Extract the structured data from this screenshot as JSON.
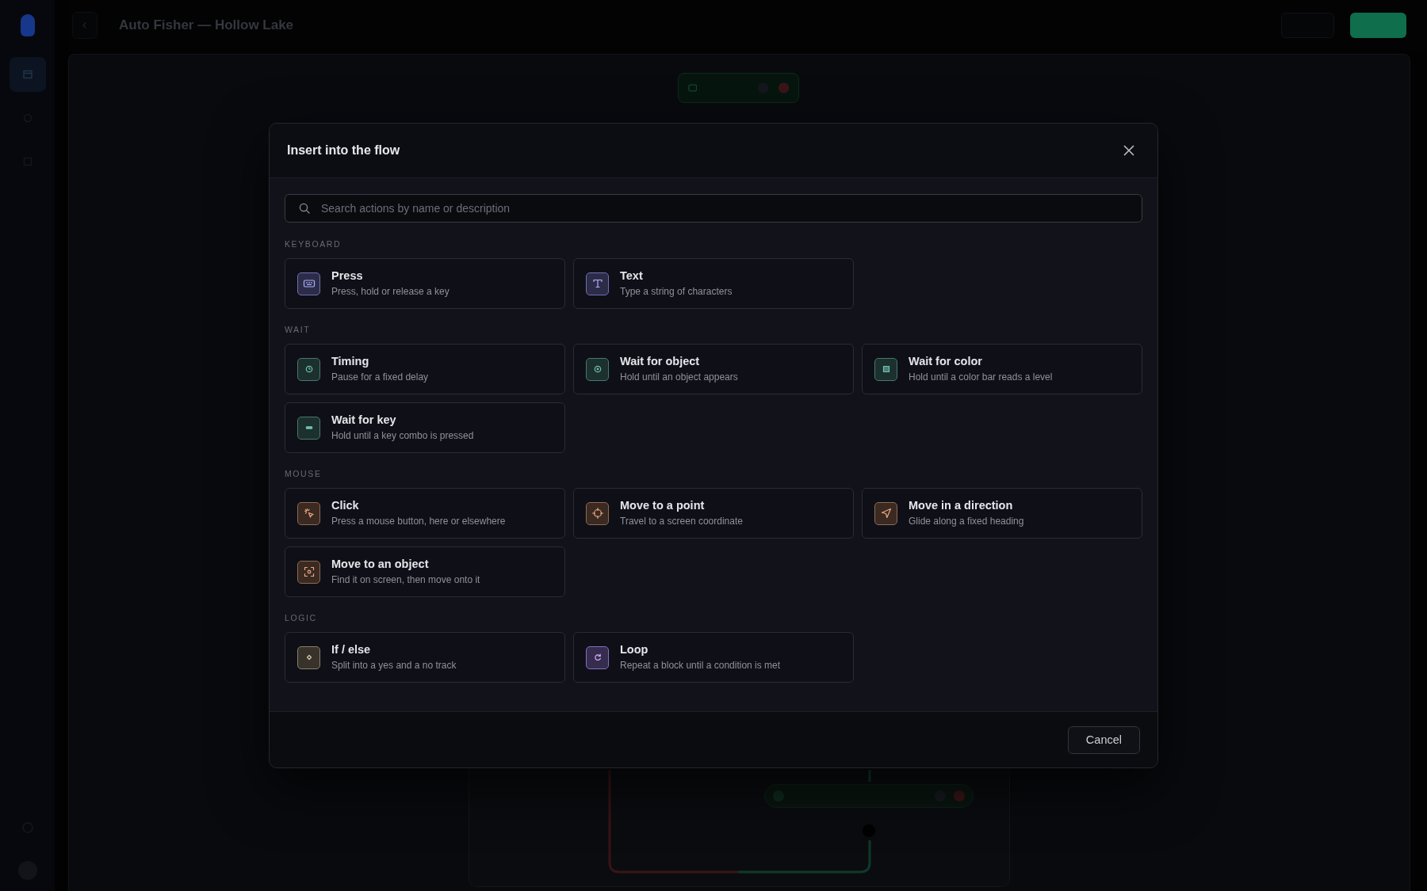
{
  "app": {
    "title": "Auto Fisher — Hollow Lake"
  },
  "sidebar": {
    "items": [
      {
        "selected": true
      },
      {
        "selected": false
      },
      {
        "selected": false
      }
    ]
  },
  "dialog": {
    "title": "Insert into the flow",
    "search": {
      "placeholder": "Search actions by name or description"
    },
    "groups": [
      {
        "label": "KEYBOARD",
        "items": [
          {
            "title": "Press",
            "description": "Press, hold or release a key",
            "color": "#2c2c48"
          },
          {
            "title": "Text",
            "description": "Type a string of characters",
            "color": "#2c2c48"
          }
        ]
      },
      {
        "label": "WAIT",
        "items": [
          {
            "title": "Timing",
            "description": "Pause for a fixed delay",
            "color": "#1c302d"
          },
          {
            "title": "Wait for object",
            "description": "Hold until an object appears",
            "color": "#1c302d"
          },
          {
            "title": "Wait for color",
            "description": "Hold until a color bar reads a level",
            "color": "#1c302d"
          },
          {
            "title": "Wait for key",
            "description": "Hold until a key combo is pressed",
            "color": "#1c302d"
          }
        ]
      },
      {
        "label": "MOUSE",
        "items": [
          {
            "title": "Click",
            "description": "Press a mouse button, here or elsewhere",
            "color": "#3a2a21"
          },
          {
            "title": "Move to a point",
            "description": "Travel to a screen coordinate",
            "color": "#3a2a21"
          },
          {
            "title": "Move in a direction",
            "description": "Glide along a fixed heading",
            "color": "#3a2a21"
          },
          {
            "title": "Move to an object",
            "description": "Find it on screen, then move onto it",
            "color": "#3a2a21"
          }
        ]
      },
      {
        "label": "LOGIC",
        "items": [
          {
            "title": "If / else",
            "description": "Split into a yes and a no track",
            "color": "#37332a"
          },
          {
            "title": "Loop",
            "description": "Repeat a block until a condition is met",
            "color": "#362c4e"
          }
        ]
      }
    ],
    "buttons": [
      {
        "label": "Cancel"
      }
    ]
  }
}
